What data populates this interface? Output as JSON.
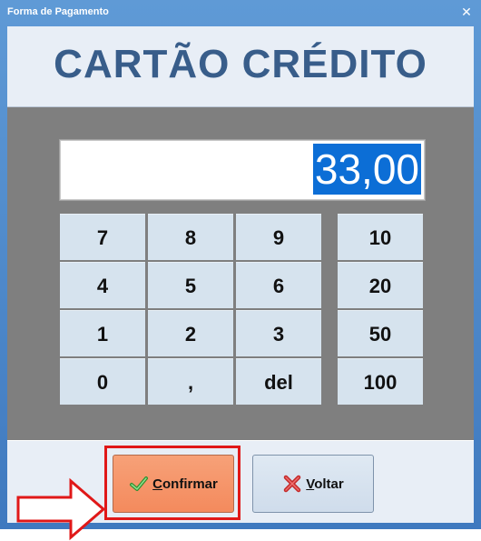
{
  "window": {
    "title": "Forma de Pagamento",
    "close_glyph": "✕"
  },
  "header": {
    "title": "CARTÃO CRÉDITO"
  },
  "display": {
    "value": "33,00"
  },
  "keypad": {
    "digits": [
      "7",
      "8",
      "9",
      "4",
      "5",
      "6",
      "1",
      "2",
      "3",
      "0",
      ",",
      "del"
    ],
    "quick_amounts": [
      "10",
      "20",
      "50",
      "100"
    ]
  },
  "buttons": {
    "confirm": {
      "first_letter": "C",
      "rest": "onfirmar",
      "icon": "checkmark-icon"
    },
    "back": {
      "first_letter": "V",
      "rest": "oltar",
      "icon": "x-icon"
    }
  },
  "colors": {
    "titlebar": "#4d8ad0",
    "header_text": "#385d8a",
    "keypad_bg": "#7f7f7f",
    "key_bg": "#d6e3ee",
    "display_highlight": "#0c6ed6",
    "confirm_bg": "#f48a5d",
    "annotation_red": "#e01818"
  }
}
